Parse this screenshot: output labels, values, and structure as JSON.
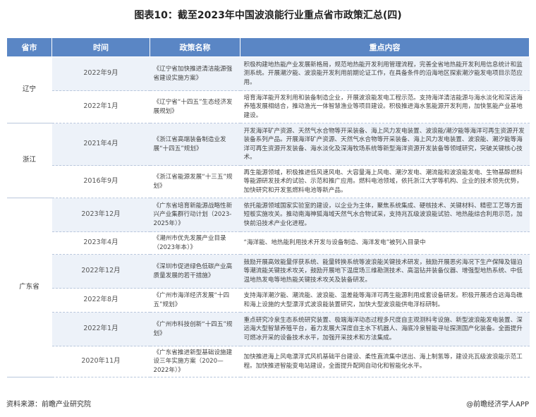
{
  "title": "图表10：截至2023年中国波浪能行业重点省市政策汇总(四)",
  "columns": [
    "省市",
    "时间",
    "政策名称",
    "重点内容"
  ],
  "rows": [
    {
      "time": "2022年9月",
      "policy": "《辽宁省加快推进清洁能源强省建设实施方案》",
      "content": "积极构建地热能产业发展新格局，规范地热能开发利用管理流程，完善全省地热能开发利用信息统计和监测系统。开展潮汐能、波浪能开发利用前期论证工作，在具备条件的沿海地区探索潮汐能发电项目示范应用。"
    },
    {
      "time": "2022年1月",
      "policy": "《辽宁省“十四五”生态经济发展规划》",
      "content": "培育海洋能开发利用和装备制造企业，开展波浪能发电工程示范。支持海洋清洁能源与海水淡化和深远海养殖发展相结合，推动渔光一体智慧渔业等项目建设。积极推进海水氢能源开发利用，加快氢能产业基地建设。"
    },
    {
      "time": "2021年4月",
      "policy": "《浙江省高端装备制造业发展“十四五”规划》",
      "content": "开发海洋矿产资源、天然气水合物等开采装备、海上风力发电装置、波浪能/潮汐能等海洋可再生资源开发装备系列产品。开展海洋矿产资源、天然气水合物等开采装备、海上风力发电装置、波浪能、潮汐能等海洋可再生资源开发装备、海水淡化及深海牧场系统等新型海洋资源开发装备等领域研究，突破关键核心技术。"
    },
    {
      "time": "2016年9月",
      "policy": "《浙江省能源发展“十三五”规划》",
      "content": "再生能源领域，积极推进低风速风电、大容量海上风电、潮汐发电、潮流能和波浪能发电、生物基醇燃料等能源研发技术的试验、示范和推广应用。燃料电池领域，依托浙江大学等机构、企业的技术领先优势，加快研究和开发氢燃料电池等新产品。"
    },
    {
      "time": "2023年12月",
      "policy": "《广东省培育新能源战略性新兴产业集群行动计划（2023-2025年）》",
      "content": "依托能源领域国家实验室的建设，以企业为主体，聚焦系统集成、硬核技术、关键材料、精密工艺等方面短板实施攻关。推动南海神狐海域天然气水合物试采，支持兆瓦级波浪能试验、地热能综合利用示范，加快前沿技术产业化进程。"
    },
    {
      "time": "2023年4月",
      "policy": "《潮州市优先发展产业目录（2023年本）》",
      "content": "“海洋能、地热能利用技术开发与设备制造、海洋发电”被列入目录中"
    },
    {
      "time": "2022年12月",
      "policy": "《深圳市促进绿色低碳产业高质量发展的若干措施》",
      "content": "鼓励开展高效能量俘获系统、能量转换系统等波浪能关键技术研发，鼓励开展恶劣海况下生产保障及锚泊等潮流能关键技术攻关，鼓励开展地下温度场三维勘测技术、高温钻井装备仪器、增强型地热系统、中低温地热发电等地热能关键技术攻关及装备研发。"
    },
    {
      "time": "2022年8月",
      "policy": "《广州市海洋经济发展“十四五”规划》",
      "content": "支持海洋潮汐能、潮流能、波浪能、温差能等海洋可再生能源利用成套设备研发。积极开展适合远海岛礁和海上设施的大型漂浮式波浪能装置研究，加快大型波浪能供电浮标研制。"
    },
    {
      "time": "2022年1月",
      "policy": "《广州市科技创新“十四五”规划》",
      "content": "重点研究冷泉生态系统研究装置、极端海洋动态过程多尺度自主观测科考设施、新型波浪能发电装置、深远海大型智慧养殖平台，着力发展大深度自主水下机器人、海底冷泉智能寻址探测国产化装备。全面提升可燃冰开采的设备技术水平，加强开采技术和方法集成。"
    },
    {
      "time": "2020年11月",
      "policy": "《广东省推进新型基础设施建设三年实施方案（2020—2022年）》",
      "content": "加快推进海上风电漂浮式风机基础平台建设、柔性直流集中送出、海上制氢等，建设兆瓦级波浪能示范工程。加快推进智能变电站建设，全面提升配网自动化和智能化水平。"
    }
  ],
  "provinces": [
    "辽宁",
    "浙江",
    "广东省"
  ],
  "footer": {
    "source": "资料来源：前瞻产业研究院",
    "brand": "@前瞻经济学人APP"
  }
}
